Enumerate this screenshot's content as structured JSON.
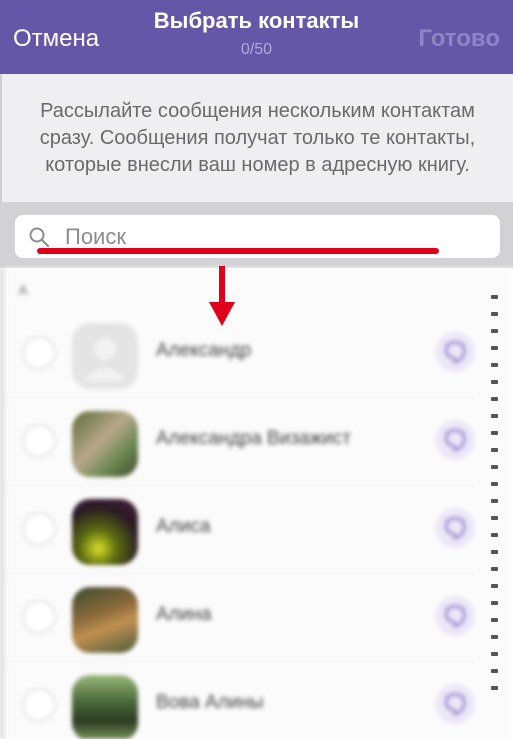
{
  "header": {
    "cancel_label": "Отмена",
    "title": "Выбрать контакты",
    "counter": "0/50",
    "done_label": "Готово"
  },
  "info": {
    "text": "Рассылайте сообщения нескольким контактам сразу. Сообщения получат только те контакты, которые внесли ваш номер в адресную книгу."
  },
  "search": {
    "placeholder": "Поиск",
    "icon": "search-icon"
  },
  "contacts": {
    "section_letter": "А",
    "items": [
      {
        "name": "Александр",
        "avatar": "placeholder",
        "selected": false
      },
      {
        "name": "Александра Визажист",
        "avatar": "photo",
        "selected": false
      },
      {
        "name": "Алиса",
        "avatar": "photo",
        "selected": false
      },
      {
        "name": "Алина",
        "avatar": "photo",
        "selected": false
      },
      {
        "name": "Вова Алины",
        "avatar": "photo",
        "selected": false
      }
    ]
  },
  "colors": {
    "header_bg": "#6457a8",
    "annotation_red": "#e0001a",
    "viber_icon_bg": "#ebe7f6"
  },
  "annotations": {
    "underline": "red-underline",
    "arrow": "down-arrow-icon"
  }
}
